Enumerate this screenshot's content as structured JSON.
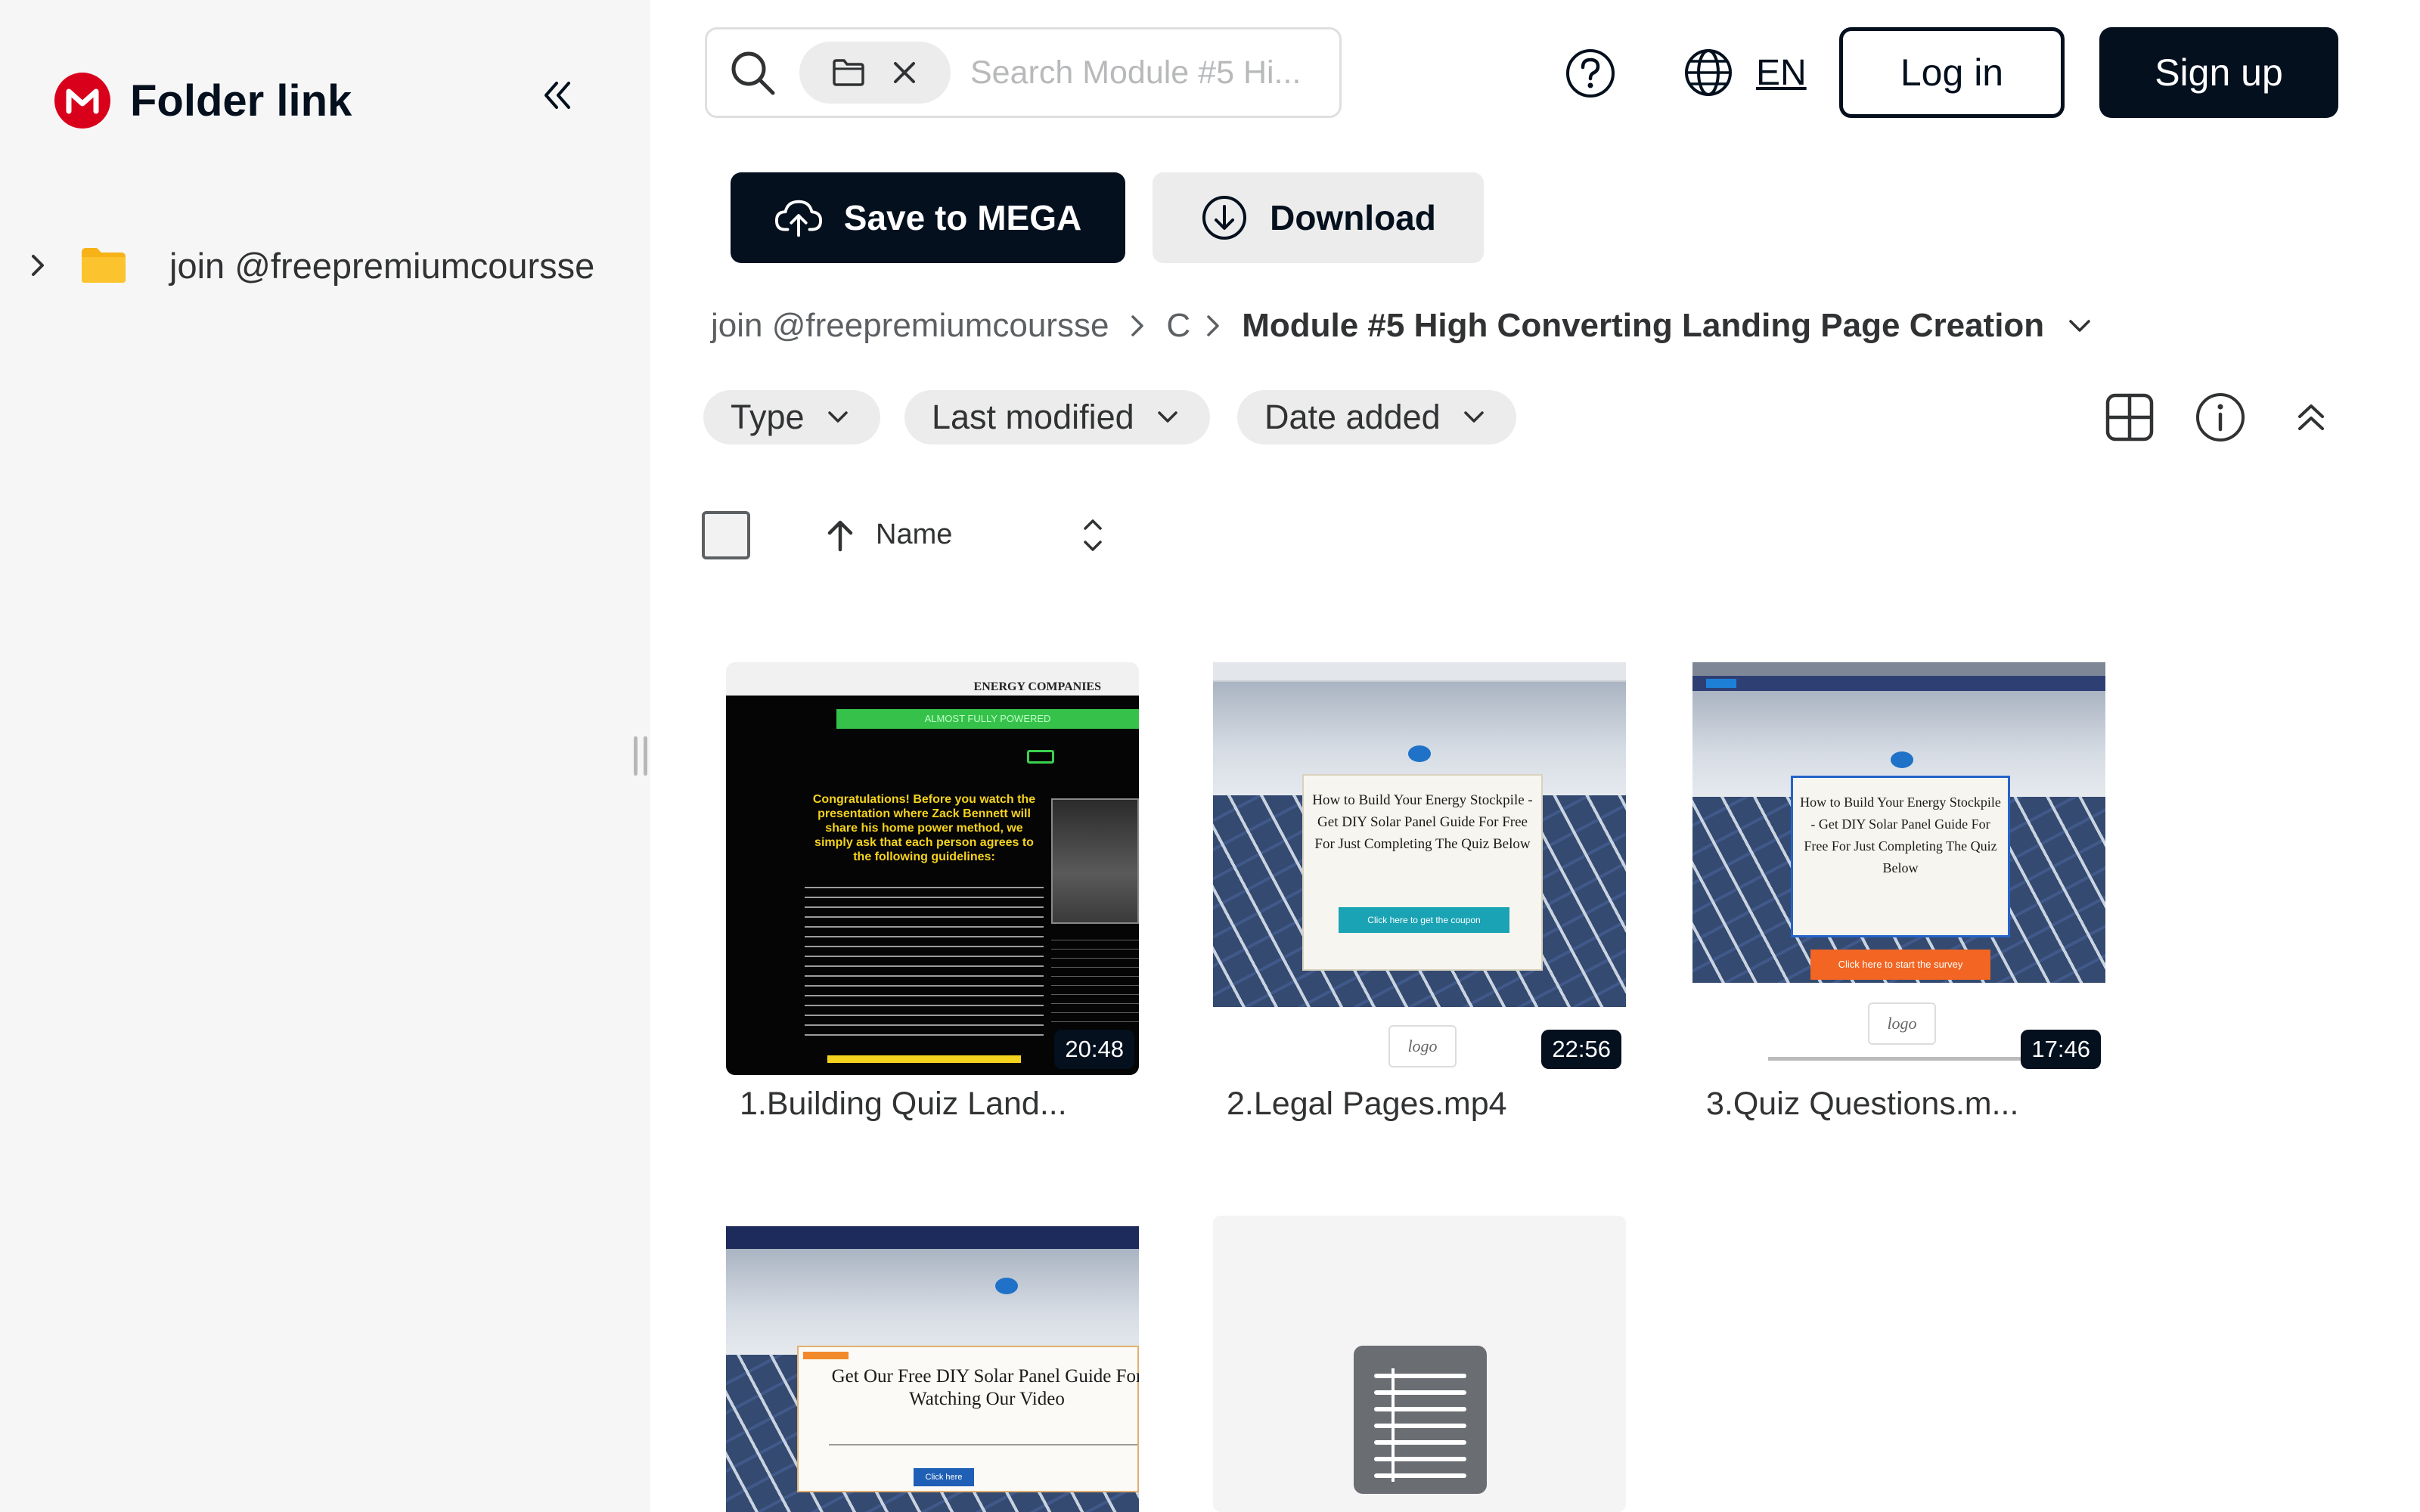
{
  "brand": {
    "title": "Folder link"
  },
  "sidebar": {
    "tree": [
      {
        "label": "join @freepremiumcoursse"
      }
    ]
  },
  "header": {
    "search_placeholder": "Search Module #5 Hi...",
    "language": "EN",
    "login_label": "Log in",
    "signup_label": "Sign up"
  },
  "actions": {
    "save_label": "Save to MEGA",
    "download_label": "Download"
  },
  "breadcrumb": {
    "items": [
      "join @freepremiumcoursse",
      "C"
    ],
    "current": "Module #5 High Converting Landing Page Creation"
  },
  "filters": [
    "Type",
    "Last modified",
    "Date added"
  ],
  "sort": {
    "label": "Name"
  },
  "files": [
    {
      "name": "1.Building Quiz Land...",
      "duration": "20:48",
      "thumb": "dark-quiz"
    },
    {
      "name": "2.Legal Pages.mp4",
      "duration": "22:56",
      "thumb": "solar-teal"
    },
    {
      "name": "3.Quiz Questions.m...",
      "duration": "17:46",
      "thumb": "solar-orange"
    },
    {
      "name": "",
      "duration": "",
      "thumb": "solar-guide"
    },
    {
      "name": "",
      "duration": "",
      "thumb": "document-icon"
    }
  ],
  "thumb_text": {
    "quiz_header": "ENERGY COMPANIES",
    "quiz_banner": "ALMOST FULLY POWERED",
    "quiz_title": "Congratulations! Before you watch the presentation where Zack Bennett will share his home power method, we simply ask that each person agrees to the following guidelines:",
    "solar_card": "How to Build Your Energy Stockpile - Get DIY Solar Panel Guide For Free For Just Completing The Quiz Below",
    "teal_button": "Click here to get the coupon",
    "orange_button": "Click here to start the survey",
    "logo": "logo",
    "guide_card": "Get Our Free DIY Solar Panel Guide For Watching Our Video",
    "guide_button": "Click here"
  },
  "colors": {
    "brand_red": "#d9001b",
    "primary": "#04101e",
    "chip": "#ececec",
    "sidebar": "#f6f6f6",
    "folder": "#f7b217"
  }
}
